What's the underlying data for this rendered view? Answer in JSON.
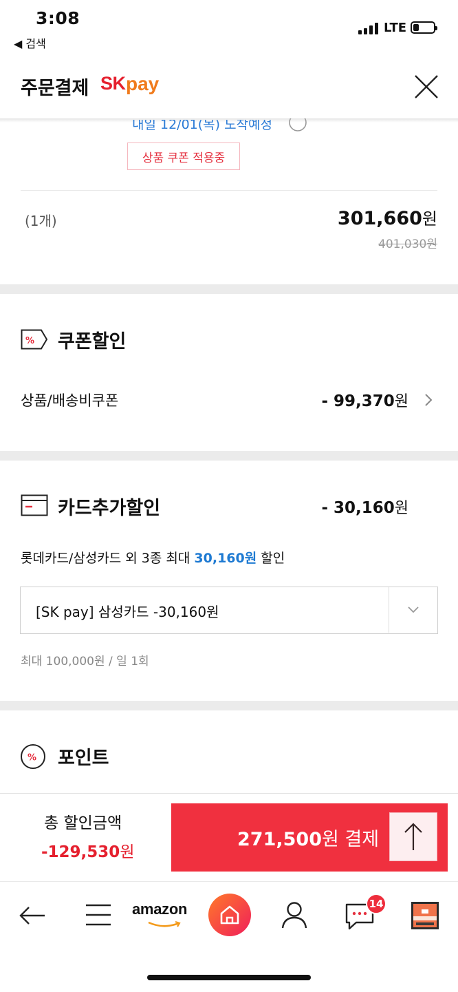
{
  "status_bar": {
    "time": "3:08",
    "back_app": "◀ 검색",
    "network": "LTE"
  },
  "header": {
    "title": "주문결제",
    "brand_sk": "SK",
    "brand_pay": "pay"
  },
  "product": {
    "partial_text": "내일 12/01(목) 도착예정",
    "coupon_tag": "상품 쿠폰 적용중",
    "quantity": "(1개)",
    "price_now": "301,660",
    "price_unit": "원",
    "price_original": "401,030원"
  },
  "coupon_section": {
    "title": "쿠폰할인",
    "row_label": "상품/배송비쿠폰",
    "amount": "- 99,370",
    "unit": "원"
  },
  "card_section": {
    "title": "카드추가할인",
    "amount": "- 30,160",
    "unit": "원",
    "desc_prefix": "롯데카드/삼성카드 외 3종 최대 ",
    "desc_highlight": "30,160원",
    "desc_suffix": " 할인",
    "selected_option": "[SK pay] 삼성카드 -30,160원",
    "limit_note": "최대 100,000원 / 일 1회"
  },
  "point_section": {
    "title": "포인트"
  },
  "summary": {
    "total_discount_label": "총 할인금액",
    "total_discount_value": "-129,530",
    "unit": "원",
    "pay_amount": "271,500",
    "pay_label_suffix": "원 결제"
  },
  "bottom_nav": {
    "amazon_label": "amazon",
    "chat_badge": "14"
  },
  "colors": {
    "accent_red": "#f0303f",
    "link_blue": "#1e7ad2",
    "sk_red": "#e5202e",
    "pay_orange": "#f07b1d"
  }
}
